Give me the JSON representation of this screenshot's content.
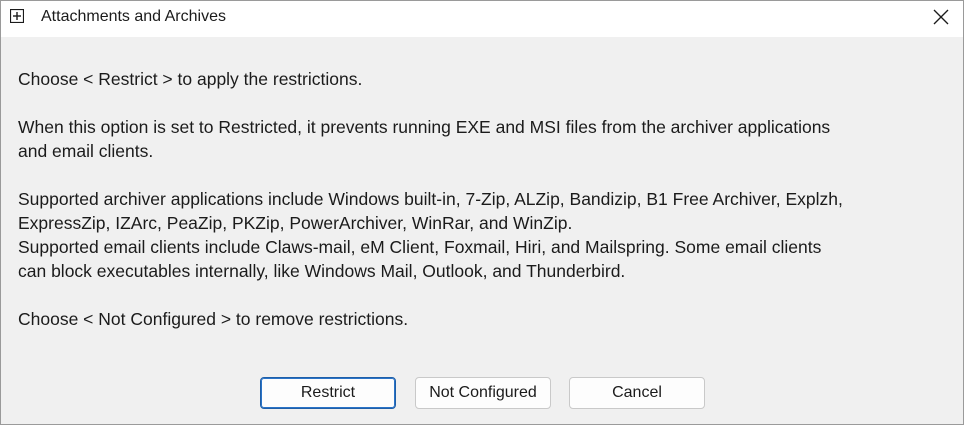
{
  "window": {
    "title": "Attachments and Archives",
    "icon": "plus-box-icon",
    "close_icon": "close-icon"
  },
  "body": {
    "line1": "Choose < Restrict > to apply the restrictions.",
    "line2a": "When this option is set to Restricted, it prevents running EXE and MSI files from the archiver applications",
    "line2b": "and email clients.",
    "line3a": "Supported archiver applications include Windows built-in, 7-Zip, ALZip, Bandizip, B1 Free Archiver, Explzh,",
    "line3b": "ExpressZip, IZArc, PeaZip, PKZip, PowerArchiver, WinRar, and WinZip.",
    "line4a": "Supported email clients include Claws-mail, eM Client, Foxmail, Hiri, and Mailspring. Some email clients",
    "line4b": "can block executables internally, like Windows Mail, Outlook, and Thunderbird.",
    "line5": "Choose < Not Configured > to remove restrictions."
  },
  "buttons": {
    "restrict": "Restrict",
    "not_configured": "Not Configured",
    "cancel": "Cancel"
  }
}
